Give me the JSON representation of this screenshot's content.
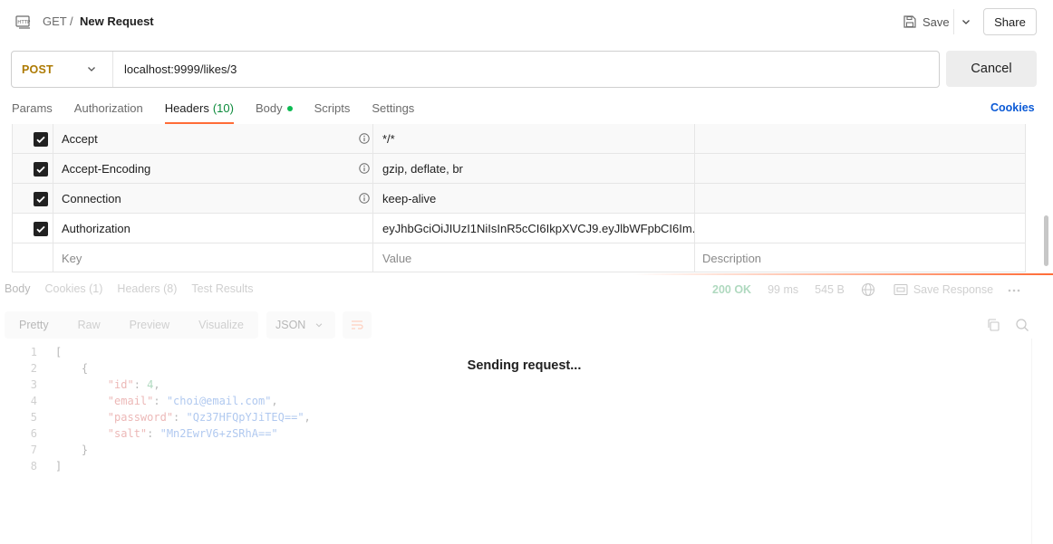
{
  "header": {
    "method": "GET",
    "separator": "/",
    "request_name": "New Request",
    "save_label": "Save",
    "share_label": "Share"
  },
  "urlbar": {
    "method": "POST",
    "url": "localhost:9999/likes/3",
    "cancel_label": "Cancel"
  },
  "request_tabs": {
    "params": "Params",
    "authorization": "Authorization",
    "headers": "Headers",
    "headers_count": "(10)",
    "body": "Body",
    "scripts": "Scripts",
    "settings": "Settings",
    "cookies": "Cookies"
  },
  "headers_table": {
    "rows": [
      {
        "key": "Accept",
        "value": "*/*",
        "description": ""
      },
      {
        "key": "Accept-Encoding",
        "value": "gzip, deflate, br",
        "description": ""
      },
      {
        "key": "Connection",
        "value": "keep-alive",
        "description": ""
      },
      {
        "key": "Authorization",
        "value": "eyJhbGciOiJIUzI1NiIsInR5cCI6IkpXVCJ9.eyJlbWFpbCI6Im...",
        "description": ""
      }
    ],
    "placeholder": {
      "key": "Key",
      "value": "Value",
      "description": "Description"
    }
  },
  "response": {
    "tabs": {
      "body": "Body",
      "cookies": "Cookies (1)",
      "headers": "Headers (8)",
      "tests": "Test Results"
    },
    "status": "200 OK",
    "time": "99 ms",
    "size": "545 B",
    "save_response": "Save Response",
    "formats": {
      "pretty": "Pretty",
      "raw": "Raw",
      "preview": "Preview",
      "visualize": "Visualize"
    },
    "language": "JSON",
    "code_lines": [
      "1",
      "2",
      "3",
      "4",
      "5",
      "6",
      "7",
      "8"
    ],
    "body": {
      "open_bracket": "[",
      "open_brace": "{",
      "id_key": "\"id\"",
      "id_val": "4",
      "email_key": "\"email\"",
      "email_val": "\"choi@email.com\"",
      "password_key": "\"password\"",
      "password_val": "\"Qz37HFQpYJiTEQ==\"",
      "salt_key": "\"salt\"",
      "salt_val": "\"Mn2EwrV6+zSRhA==\"",
      "close_brace": "}",
      "close_bracket": "]"
    }
  },
  "overlay": {
    "sending": "Sending request..."
  },
  "colors": {
    "method_post": "#ad7a03",
    "accent": "#ff6c37",
    "link": "#0b5ad6",
    "status_ok": "#0b8a3a"
  }
}
